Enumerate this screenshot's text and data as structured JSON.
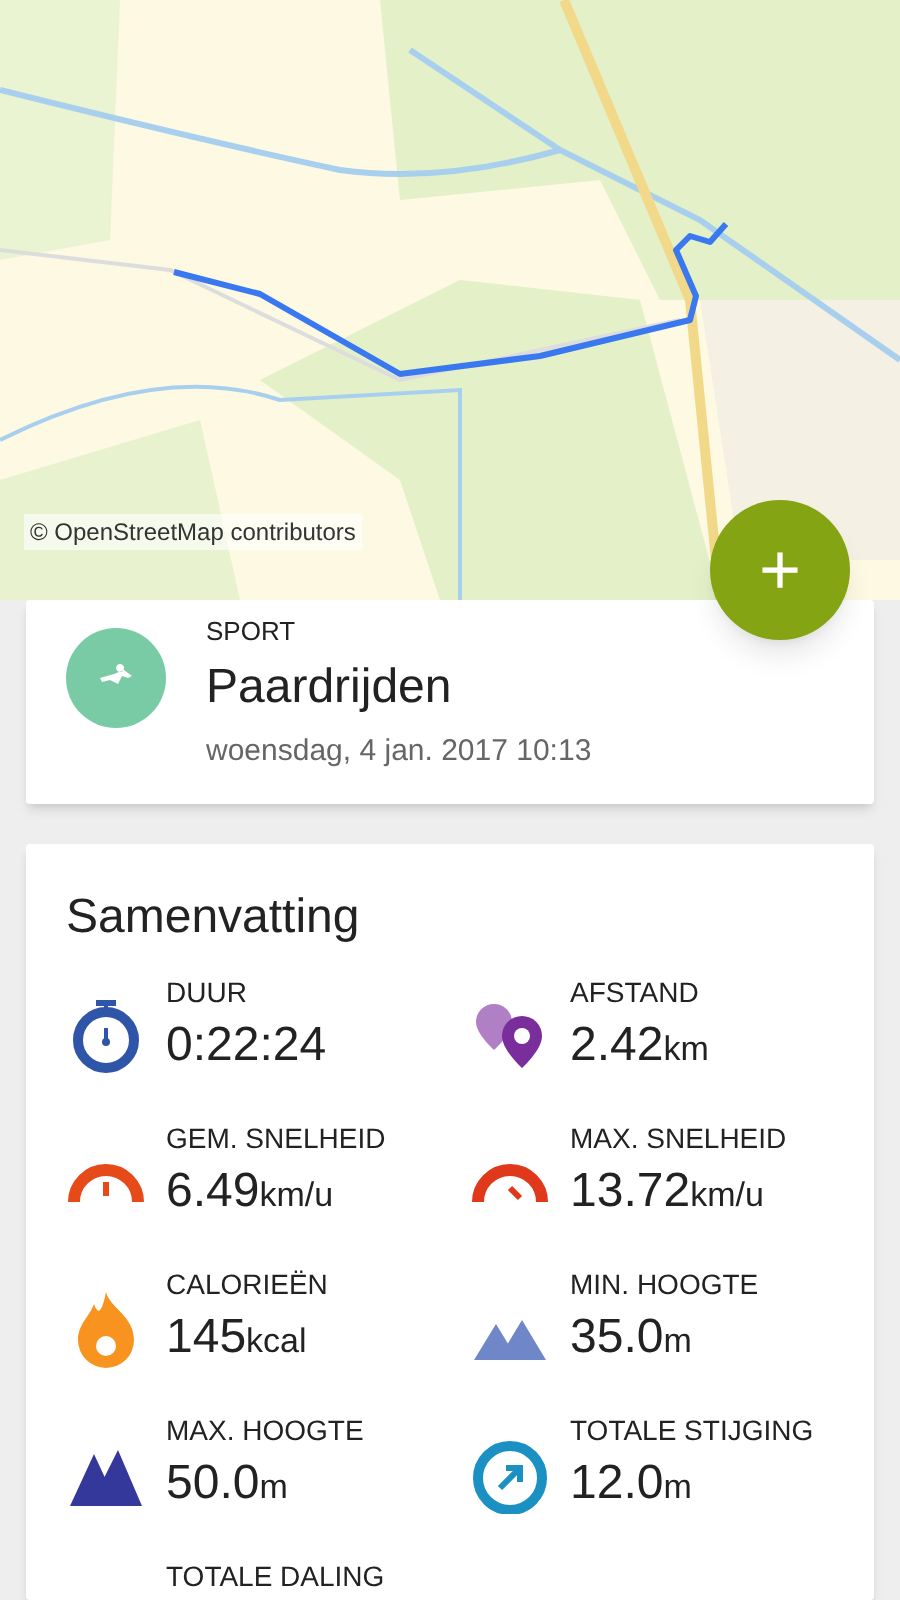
{
  "map": {
    "attribution": "© OpenStreetMap contributors"
  },
  "fab": {
    "label": "+"
  },
  "activity": {
    "label": "SPORT",
    "sport": "Paardrijden",
    "date": "woensdag, 4 jan. 2017 10:13"
  },
  "summary": {
    "title": "Samenvatting",
    "stats": [
      {
        "kind": "duration",
        "label": "DUUR",
        "value": "0:22:24"
      },
      {
        "kind": "distance",
        "label": "AFSTAND",
        "value": "2.42",
        "unit": "km"
      },
      {
        "kind": "avg_speed",
        "label": "GEM. SNELHEID",
        "value": "6.49",
        "unit": "km/u"
      },
      {
        "kind": "max_speed",
        "label": "MAX. SNELHEID",
        "value": "13.72",
        "unit": "km/u"
      },
      {
        "kind": "calories",
        "label": "CALORIEËN",
        "value": "145",
        "unit": "kcal"
      },
      {
        "kind": "min_altitude",
        "label": "MIN. HOOGTE",
        "value": "35.0",
        "unit": "m"
      },
      {
        "kind": "max_altitude",
        "label": "MAX. HOOGTE",
        "value": "50.0",
        "unit": "m"
      },
      {
        "kind": "ascent",
        "label": "TOTALE STIJGING",
        "value": "12.0",
        "unit": "m"
      },
      {
        "kind": "descent",
        "label": "TOTALE DALING"
      }
    ]
  }
}
